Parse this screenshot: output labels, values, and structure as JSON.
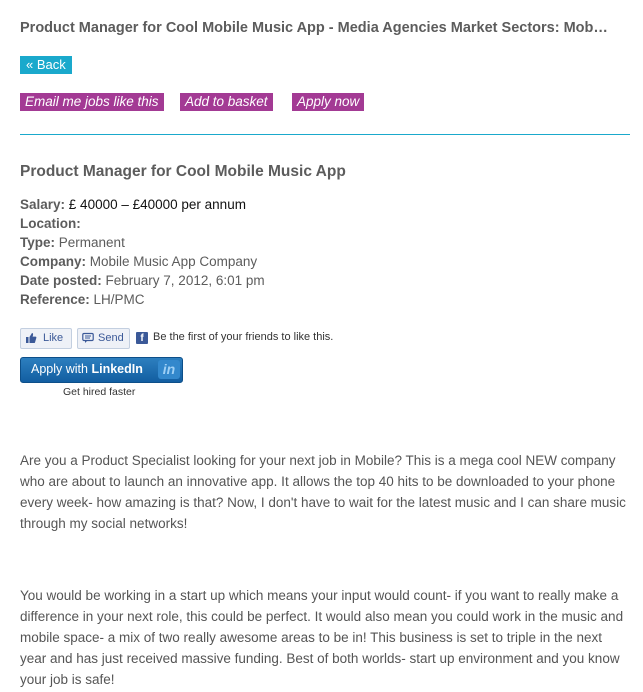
{
  "header": {
    "title": "Product Manager for Cool Mobile Music App - Media Agencies Market Sectors: Mob…"
  },
  "actions": {
    "back": "« Back",
    "email_jobs": "Email me jobs like this",
    "add_basket": "Add to basket",
    "apply_now": "Apply now"
  },
  "job": {
    "title": "Product Manager for Cool Mobile Music App",
    "salary_label": "Salary:",
    "salary_value": "£ 40000 – £40000 per annum",
    "location_label": "Location:",
    "type_label": "Type:",
    "type_value": "Permanent",
    "company_label": "Company:",
    "company_value": "Mobile Music App Company",
    "date_label": "Date posted:",
    "date_value": "February 7, 2012, 6:01 pm",
    "ref_label": "Reference:",
    "ref_value": "LH/PMC"
  },
  "social": {
    "like": "Like",
    "send": "Send",
    "fb_text": "Be the first of your friends to like this.",
    "linkedin_prefix": "Apply with",
    "linkedin_brand": "LinkedIn",
    "linkedin_sub": "Get hired faster"
  },
  "description": {
    "p1": "Are you a Product Specialist looking for your next job in Mobile? This is a mega cool NEW company who are about to launch an innovative app. It allows the top 40 hits to be downloaded to your phone every week- how amazing is that? Now, I don't have to wait for the latest music and I can share music through my social networks!",
    "p2": "You would be working in a start up which means your input would count- if you want to really make a difference in your next role, this could be perfect. It would also mean you could work in the music and mobile space- a mix of two really awesome areas to be in! This business is set to triple in the next year and has just received massive funding. Best of both worlds- start up environment and you know your job is safe!"
  },
  "colors": {
    "accent": "#1aa9cc",
    "button_pink": "#a33a94",
    "facebook": "#3b5998",
    "linkedin": "#1d6fb0"
  }
}
